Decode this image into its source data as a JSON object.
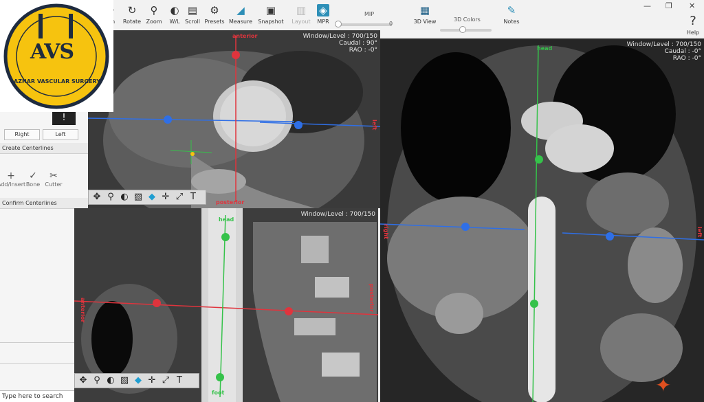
{
  "toolbar": {
    "tools": [
      {
        "label": "Pan",
        "icon": "pan-icon"
      },
      {
        "label": "Rotate",
        "icon": "rotate-icon"
      },
      {
        "label": "Zoom",
        "icon": "zoom-icon"
      },
      {
        "label": "W/L",
        "icon": "window-level-icon"
      },
      {
        "label": "Scroll",
        "icon": "scroll-icon"
      },
      {
        "label": "Presets",
        "icon": "gear-icon"
      },
      {
        "label": "Measure",
        "icon": "measure-icon"
      },
      {
        "label": "Snapshot",
        "icon": "camera-icon"
      },
      {
        "label": "Layout",
        "icon": "layout-icon"
      },
      {
        "label": "MPR",
        "icon": "mpr-icon"
      }
    ],
    "mip": {
      "label": "MIP",
      "value": "0"
    },
    "view3d": {
      "label": "3D View"
    },
    "colors3d": {
      "label": "3D Colors"
    },
    "notes": {
      "label": "Notes"
    },
    "help": {
      "label": "Help"
    }
  },
  "left_panel": {
    "right_button": "Right",
    "left_button": "Left",
    "create_centerlines": "Create Centerlines",
    "tools": [
      {
        "label": "Add/Insert",
        "icon": "plus-icon"
      },
      {
        "label": "Bone",
        "icon": "checkmark-icon"
      },
      {
        "label": "Cutter",
        "icon": "scissors-icon"
      }
    ],
    "confirm_centerlines": "Confirm Centerlines",
    "search_placeholder": "Type here to search"
  },
  "viewports": {
    "axial": {
      "info": [
        "Window/Level : 700/150",
        "Caudal : 90°",
        "RAO : -0°"
      ],
      "label_top": "anterior",
      "label_right": "left",
      "label_bottom": "posterior"
    },
    "sagittal": {
      "info": [
        "Window/Level : 700/150"
      ],
      "label_top": "head",
      "label_left": "anterior",
      "label_right": "posterior",
      "label_bottom": "foot"
    },
    "coronal": {
      "info": [
        "Window/Level : 700/150",
        "Caudal : -0°",
        "RAO : -0°"
      ],
      "label_top": "head",
      "label_left": "right",
      "label_right": "left"
    }
  },
  "logo": {
    "text": "AVS",
    "subtitle": "AZHAR VASCULAR SURGERY"
  },
  "colors": {
    "accent": "#2d8fb7",
    "crosshair_red": "#e0343d",
    "crosshair_blue": "#2f6fe6",
    "crosshair_green": "#35c24a",
    "logo_yellow": "#f6c30f"
  }
}
